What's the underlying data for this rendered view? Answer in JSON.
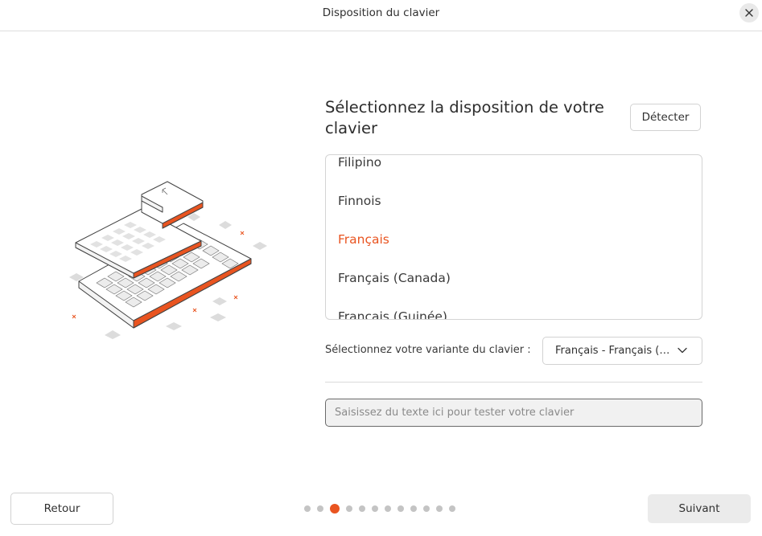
{
  "window": {
    "title": "Disposition du clavier"
  },
  "heading": "Sélectionnez la disposition de votre clavier",
  "detect_label": "Détecter",
  "layouts": [
    {
      "label": "Filipino",
      "selected": false
    },
    {
      "label": "Finnois",
      "selected": false
    },
    {
      "label": "Français",
      "selected": true
    },
    {
      "label": "Français (Canada)",
      "selected": false
    },
    {
      "label": "Français (Guinée)",
      "selected": false
    }
  ],
  "variant": {
    "label": "Sélectionnez votre variante du clavier :",
    "value": "Français - Français (…"
  },
  "test_input": {
    "placeholder": "Saisissez du texte ici pour tester votre clavier",
    "value": ""
  },
  "nav": {
    "back_label": "Retour",
    "next_label": "Suivant",
    "step_count": 12,
    "current_step": 3
  },
  "colors": {
    "accent": "#e95420"
  }
}
